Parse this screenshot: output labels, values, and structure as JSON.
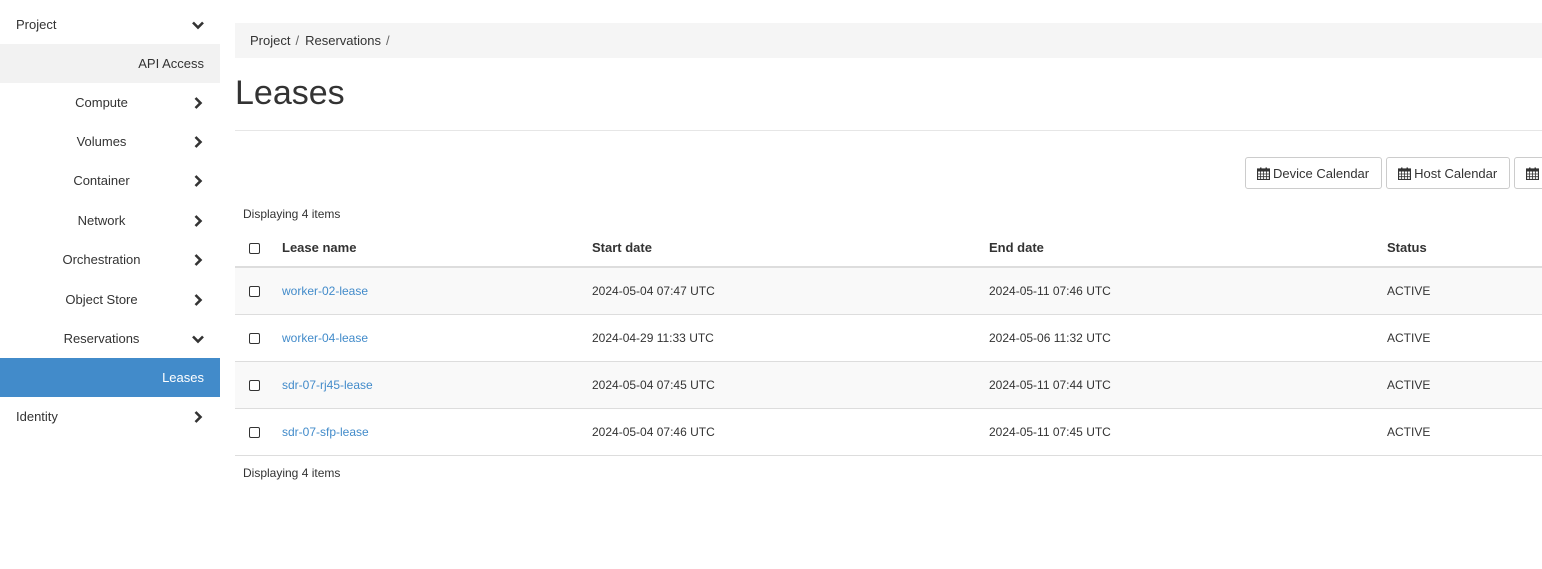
{
  "sidebar": {
    "items": [
      {
        "label": "Project",
        "icon": "chevron-down-icon",
        "level": "top"
      },
      {
        "label": "API Access",
        "icon": null,
        "level": "sub"
      },
      {
        "label": "Compute",
        "icon": "chevron-right-icon",
        "level": "sub"
      },
      {
        "label": "Volumes",
        "icon": "chevron-right-icon",
        "level": "sub"
      },
      {
        "label": "Container",
        "icon": "chevron-right-icon",
        "level": "sub"
      },
      {
        "label": "Network",
        "icon": "chevron-right-icon",
        "level": "sub"
      },
      {
        "label": "Orchestration",
        "icon": "chevron-right-icon",
        "level": "sub"
      },
      {
        "label": "Object Store",
        "icon": "chevron-right-icon",
        "level": "sub"
      },
      {
        "label": "Reservations",
        "icon": "chevron-down-icon",
        "level": "sub"
      },
      {
        "label": "Leases",
        "icon": null,
        "level": "sub-active"
      },
      {
        "label": "Identity",
        "icon": "chevron-right-icon",
        "level": "top"
      }
    ]
  },
  "breadcrumb": [
    {
      "label": "Project"
    },
    {
      "label": "Reservations"
    }
  ],
  "breadcrumb_separator": "/",
  "page": {
    "title": "Leases"
  },
  "actions": {
    "device_calendar": "Device Calendar",
    "host_calendar": "Host Calendar",
    "icon": "calendar-icon"
  },
  "table": {
    "count_top": "Displaying 4 items",
    "count_bottom": "Displaying 4 items",
    "columns": [
      "Lease name",
      "Start date",
      "End date",
      "Status"
    ],
    "rows": [
      {
        "name": "worker-02-lease",
        "start": "2024-05-04 07:47 UTC",
        "end": "2024-05-11 07:46 UTC",
        "status": "ACTIVE"
      },
      {
        "name": "worker-04-lease",
        "start": "2024-04-29 11:33 UTC",
        "end": "2024-05-06 11:32 UTC",
        "status": "ACTIVE"
      },
      {
        "name": "sdr-07-rj45-lease",
        "start": "2024-05-04 07:45 UTC",
        "end": "2024-05-11 07:44 UTC",
        "status": "ACTIVE"
      },
      {
        "name": "sdr-07-sfp-lease",
        "start": "2024-05-04 07:46 UTC",
        "end": "2024-05-11 07:45 UTC",
        "status": "ACTIVE"
      }
    ]
  },
  "colors": {
    "accent": "#428bca",
    "active_nav_bg": "#428bca",
    "breadcrumb_bg": "#f5f5f5"
  }
}
